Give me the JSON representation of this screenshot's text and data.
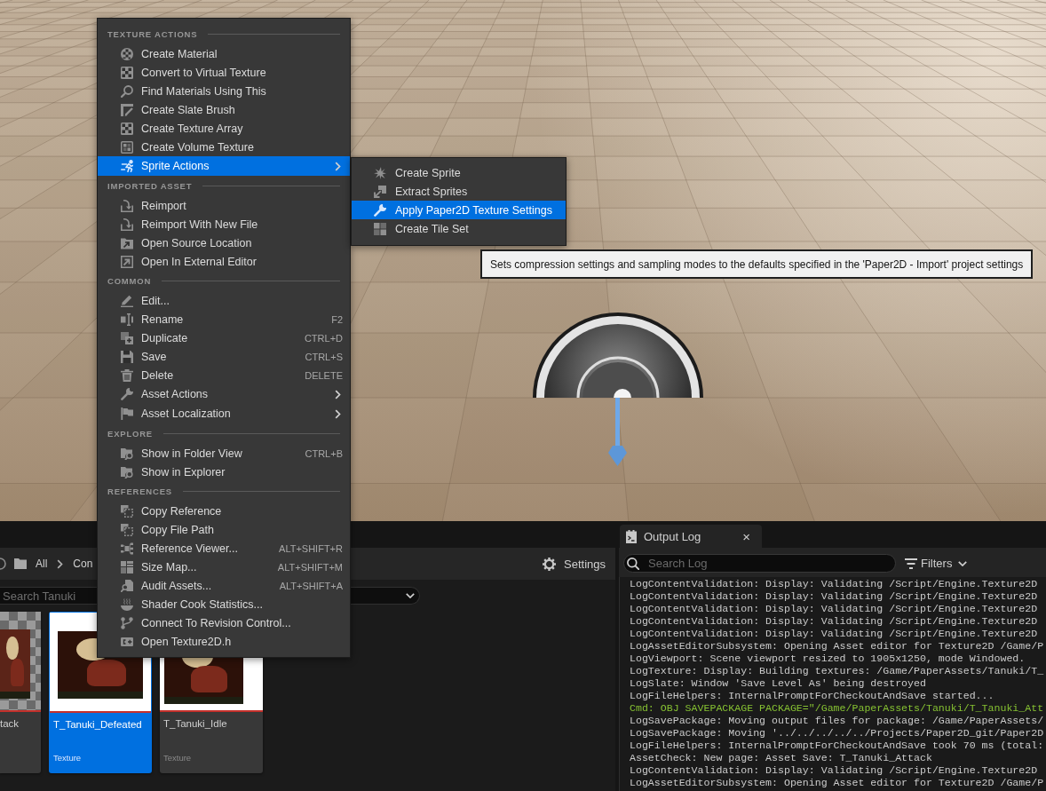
{
  "context_menu": {
    "sections": [
      {
        "title": "TEXTURE ACTIONS",
        "items": [
          {
            "label": "Create Material",
            "selected": false,
            "submenu": false
          },
          {
            "label": "Convert to Virtual Texture",
            "selected": false,
            "submenu": false
          },
          {
            "label": "Find Materials Using This",
            "selected": false,
            "submenu": false
          },
          {
            "label": "Create Slate Brush",
            "selected": false,
            "submenu": false
          },
          {
            "label": "Create Texture Array",
            "selected": false,
            "submenu": false
          },
          {
            "label": "Create Volume Texture",
            "selected": false,
            "submenu": false
          },
          {
            "label": "Sprite Actions",
            "selected": true,
            "submenu": true
          }
        ]
      },
      {
        "title": "IMPORTED ASSET",
        "items": [
          {
            "label": "Reimport",
            "selected": false,
            "submenu": false
          },
          {
            "label": "Reimport With New File",
            "selected": false,
            "submenu": false
          },
          {
            "label": "Open Source Location",
            "selected": false,
            "submenu": false
          },
          {
            "label": "Open In External Editor",
            "selected": false,
            "submenu": false
          }
        ]
      },
      {
        "title": "COMMON",
        "items": [
          {
            "label": "Edit...",
            "selected": false,
            "submenu": false
          },
          {
            "label": "Rename",
            "shortcut": "F2",
            "selected": false,
            "submenu": false
          },
          {
            "label": "Duplicate",
            "shortcut": "CTRL+D",
            "selected": false,
            "submenu": false
          },
          {
            "label": "Save",
            "shortcut": "CTRL+S",
            "selected": false,
            "submenu": false
          },
          {
            "label": "Delete",
            "shortcut": "DELETE",
            "selected": false,
            "submenu": false
          },
          {
            "label": "Asset Actions",
            "selected": false,
            "submenu": true
          },
          {
            "label": "Asset Localization",
            "selected": false,
            "submenu": true
          }
        ]
      },
      {
        "title": "EXPLORE",
        "items": [
          {
            "label": "Show in Folder View",
            "shortcut": "CTRL+B",
            "selected": false,
            "submenu": false
          },
          {
            "label": "Show in Explorer",
            "selected": false,
            "submenu": false
          }
        ]
      },
      {
        "title": "REFERENCES",
        "items": [
          {
            "label": "Copy Reference",
            "selected": false,
            "submenu": false
          },
          {
            "label": "Copy File Path",
            "selected": false,
            "submenu": false
          },
          {
            "label": "Reference Viewer...",
            "shortcut": "ALT+SHIFT+R",
            "selected": false,
            "submenu": false
          },
          {
            "label": "Size Map...",
            "shortcut": "ALT+SHIFT+M",
            "selected": false,
            "submenu": false
          },
          {
            "label": "Audit Assets...",
            "shortcut": "ALT+SHIFT+A",
            "selected": false,
            "submenu": false
          },
          {
            "label": "Shader Cook Statistics...",
            "selected": false,
            "submenu": false
          },
          {
            "label": "Connect To Revision Control...",
            "selected": false,
            "submenu": false
          },
          {
            "label": "Open Texture2D.h",
            "selected": false,
            "submenu": false
          }
        ]
      }
    ]
  },
  "submenu": {
    "items": [
      {
        "label": "Create Sprite",
        "selected": false
      },
      {
        "label": "Extract Sprites",
        "selected": false
      },
      {
        "label": "Apply Paper2D Texture Settings",
        "selected": true
      },
      {
        "label": "Create Tile Set",
        "selected": false
      }
    ]
  },
  "tooltip": {
    "text": "Sets compression settings and sampling modes to the defaults specified in the 'Paper2D - Import' project settings"
  },
  "content_browser": {
    "breadcrumb": [
      "All",
      "Con"
    ],
    "settings": "Settings",
    "search": {
      "placeholder": "Search Tanuki"
    },
    "assets": [
      {
        "name": "tack",
        "checkered": true,
        "selected": false
      },
      {
        "name": "T_Tanuki_Defeated",
        "type": "Texture",
        "checkered": false,
        "selected": true
      },
      {
        "name": "T_Tanuki_Idle",
        "type": "Texture",
        "checkered": false,
        "selected": false
      }
    ]
  },
  "output_log": {
    "tab": {
      "title": "Output Log",
      "close": "×"
    },
    "search": {
      "placeholder": "Search Log"
    },
    "filters": "Filters",
    "lines": [
      {
        "kind": "log",
        "text": "LogContentValidation: Display: Validating /Script/Engine.Texture2D"
      },
      {
        "kind": "log",
        "text": "LogContentValidation: Display: Validating /Script/Engine.Texture2D"
      },
      {
        "kind": "log",
        "text": "LogContentValidation: Display: Validating /Script/Engine.Texture2D"
      },
      {
        "kind": "log",
        "text": "LogContentValidation: Display: Validating /Script/Engine.Texture2D"
      },
      {
        "kind": "log",
        "text": "LogContentValidation: Display: Validating /Script/Engine.Texture2D"
      },
      {
        "kind": "log",
        "text": "LogAssetEditorSubsystem: Opening Asset editor for Texture2D /Game/P"
      },
      {
        "kind": "log",
        "text": "LogViewport: Scene viewport resized to 1905x1250, mode Windowed."
      },
      {
        "kind": "log",
        "text": "LogTexture: Display: Building textures: /Game/PaperAssets/Tanuki/T_"
      },
      {
        "kind": "log",
        "text": "LogSlate: Window 'Save Level As' being destroyed"
      },
      {
        "kind": "log",
        "text": "LogFileHelpers: InternalPromptForCheckoutAndSave started..."
      },
      {
        "kind": "command",
        "text": "Cmd: OBJ SAVEPACKAGE PACKAGE=\"/Game/PaperAssets/Tanuki/T_Tanuki_Att"
      },
      {
        "kind": "log",
        "text": "LogSavePackage: Moving output files for package: /Game/PaperAssets/"
      },
      {
        "kind": "log",
        "text": "LogSavePackage: Moving '../../../../../Projects/Paper2D_git/Paper2D"
      },
      {
        "kind": "log",
        "text": "LogFileHelpers: InternalPromptForCheckoutAndSave took 70 ms (total:"
      },
      {
        "kind": "log",
        "text": "AssetCheck: New page: Asset Save: T_Tanuki_Attack"
      },
      {
        "kind": "log",
        "text": "LogContentValidation: Display: Validating /Script/Engine.Texture2D"
      },
      {
        "kind": "log",
        "text": "LogAssetEditorSubsystem: Opening Asset editor for Texture2D /Game/P"
      }
    ]
  }
}
